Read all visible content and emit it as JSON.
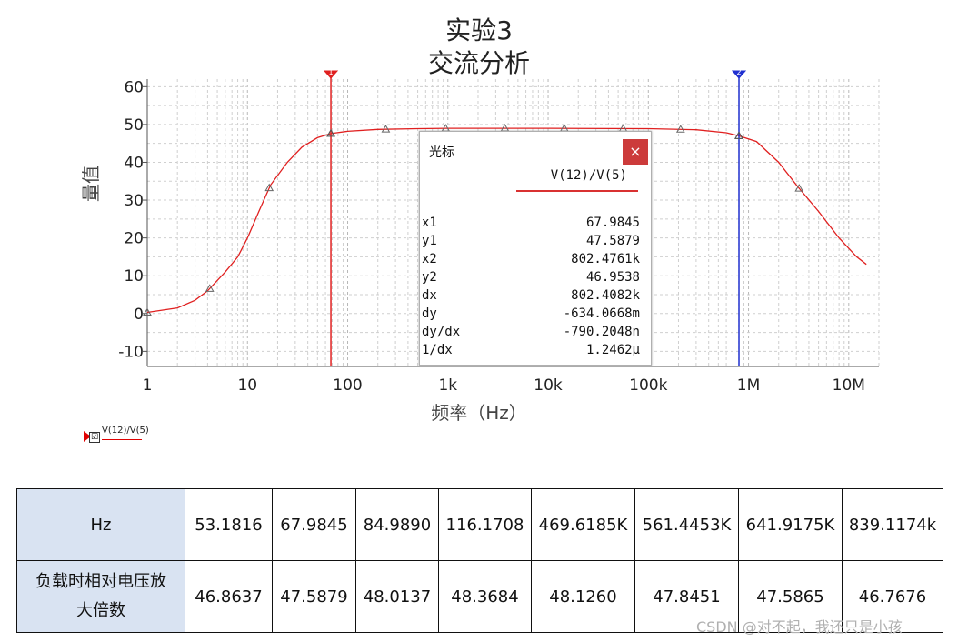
{
  "chart_data": {
    "type": "line",
    "title": "实验3",
    "subtitle": "交流分析",
    "xlabel": "频率（Hz）",
    "ylabel": "量值",
    "xscale": "log",
    "xlim": [
      1,
      20000000
    ],
    "ylim": [
      -14,
      62
    ],
    "yticks": [
      60,
      50,
      40,
      30,
      20,
      10,
      0,
      -10
    ],
    "xticks": [
      {
        "v": 1,
        "label": "1"
      },
      {
        "v": 10,
        "label": "10"
      },
      {
        "v": 100,
        "label": "100"
      },
      {
        "v": 1000,
        "label": "1k"
      },
      {
        "v": 10000,
        "label": "10k"
      },
      {
        "v": 100000,
        "label": "100k"
      },
      {
        "v": 1000000,
        "label": "1M"
      },
      {
        "v": 10000000,
        "label": "10M"
      }
    ],
    "grid": true,
    "series": [
      {
        "name": "V(12)/V(5)",
        "color": "#e02020",
        "points": [
          [
            1,
            0.3
          ],
          [
            2,
            1.5
          ],
          [
            3,
            3.5
          ],
          [
            4,
            6
          ],
          [
            6,
            11
          ],
          [
            8,
            15
          ],
          [
            10,
            20
          ],
          [
            13,
            27
          ],
          [
            17,
            34
          ],
          [
            25,
            40
          ],
          [
            35,
            44
          ],
          [
            50,
            46.5
          ],
          [
            68,
            47.6
          ],
          [
            100,
            48.2
          ],
          [
            200,
            48.7
          ],
          [
            500,
            48.9
          ],
          [
            1000,
            49
          ],
          [
            10000,
            49
          ],
          [
            100000,
            48.9
          ],
          [
            300000,
            48.6
          ],
          [
            600000,
            47.8
          ],
          [
            800000,
            47
          ],
          [
            1200000,
            45.5
          ],
          [
            2000000,
            40
          ],
          [
            3000000,
            34
          ],
          [
            5000000,
            27
          ],
          [
            8000000,
            20
          ],
          [
            12000000,
            15
          ],
          [
            15000000,
            13
          ]
        ],
        "markers": [
          1,
          4.2,
          16.5,
          68,
          240,
          950,
          3700,
          14500,
          56000,
          210000,
          800000,
          3200000
        ]
      }
    ],
    "cursors": [
      {
        "id": "1",
        "x": 67.9845,
        "color": "#e02020"
      },
      {
        "id": "2",
        "x": 802476.1,
        "color": "#2030d0"
      }
    ]
  },
  "legend": {
    "label": "V(12)/V(5)",
    "checked": "☑"
  },
  "cursor_panel": {
    "title": "光标",
    "close": "×",
    "column": "V(12)/V(5)",
    "rows": [
      {
        "k": "x1",
        "v": "67.9845"
      },
      {
        "k": "y1",
        "v": "47.5879"
      },
      {
        "k": "x2",
        "v": "802.4761k"
      },
      {
        "k": "y2",
        "v": "46.9538"
      },
      {
        "k": "dx",
        "v": "802.4082k"
      },
      {
        "k": "dy",
        "v": "-634.0668m"
      },
      {
        "k": "dy/dx",
        "v": "-790.2048n"
      },
      {
        "k": "1/dx",
        "v": "1.2462μ"
      }
    ]
  },
  "table": {
    "row1": [
      "Hz",
      "53.1816",
      "67.9845",
      "84.9890",
      "116.1708",
      "469.6185K",
      "561.4453K",
      "641.9175K",
      "839.1174k"
    ],
    "row2": [
      "负载时相对电压放大倍数",
      "46.8637",
      "47.5879",
      "48.0137",
      "48.3684",
      "48.1260",
      "47.8451",
      "47.5865",
      "46.7676"
    ]
  },
  "watermark": "CSDN @对不起，我还只是小孩"
}
